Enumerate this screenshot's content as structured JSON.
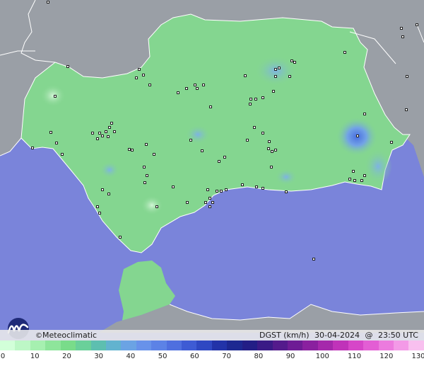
{
  "brand": {
    "copyright": "©",
    "name": "Meteoclimatic"
  },
  "caption": {
    "variable": "DGST (km/h)",
    "date": "30-04-2024",
    "at": "@",
    "time": "23:50 UTC"
  },
  "legend": {
    "ticks": [
      "0",
      "10",
      "20",
      "30",
      "40",
      "50",
      "60",
      "70",
      "80",
      "90",
      "100",
      "110",
      "120",
      "130"
    ],
    "range": [
      0,
      130
    ],
    "colors": [
      "#d2ffd9",
      "#bdf7c6",
      "#a6f0b0",
      "#8ee59b",
      "#79dc8a",
      "#6ad09a",
      "#5dbfb0",
      "#62b3cf",
      "#6ba3e4",
      "#6892ea",
      "#5c82e6",
      "#4f6fdf",
      "#3e5bd4",
      "#2f48c2",
      "#2233a8",
      "#1d2891",
      "#231e86",
      "#3a1a86",
      "#541a8c",
      "#6e1c95",
      "#8a209f",
      "#a528ab",
      "#c033b9",
      "#d646c8",
      "#e35ed4",
      "#ec7bde",
      "#f39ae7",
      "#f8c0ef"
    ]
  },
  "colors": {
    "sea": "#7a84da",
    "land_outside": "#9a9fa6",
    "land_region": "#84d690",
    "borders": "#ffffff"
  }
}
